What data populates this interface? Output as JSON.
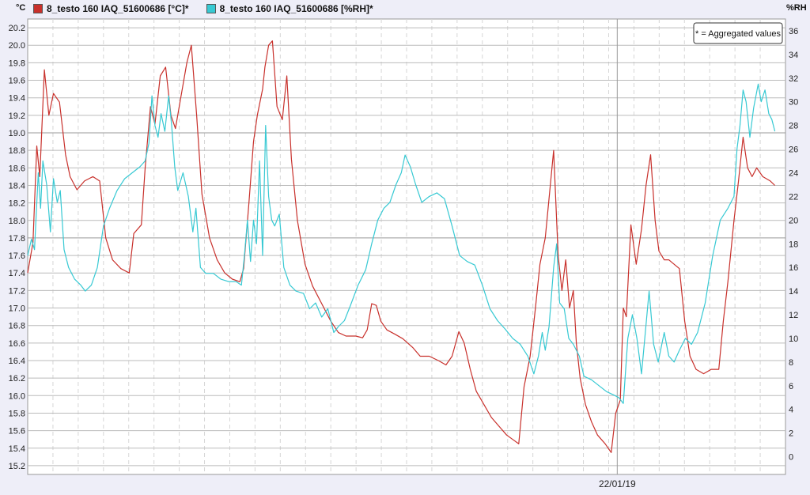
{
  "legend": {
    "temp_label": "8_testo 160 IAQ_51600686 [°C]*",
    "rh_label": "8_testo 160 IAQ_51600686 [%RH]*"
  },
  "axis_units": {
    "left": "°C",
    "right": "%RH"
  },
  "note": "* = Aggregated values",
  "colors": {
    "temp": "#c8302b",
    "rh": "#37c9d3",
    "grid": "#bbbbbb",
    "background": "#ffffff"
  },
  "chart_data": {
    "type": "line",
    "x_label": "22/01/19",
    "x_range": [
      0,
      100
    ],
    "y_left": {
      "label": "°C",
      "range": [
        15.1,
        20.3
      ],
      "ticks": [
        15.2,
        15.4,
        15.6,
        15.8,
        16.0,
        16.2,
        16.4,
        16.6,
        16.8,
        17.0,
        17.2,
        17.4,
        17.6,
        17.8,
        18.0,
        18.2,
        18.4,
        18.6,
        18.8,
        19.0,
        19.2,
        19.4,
        19.6,
        19.8,
        20.0,
        20.2
      ]
    },
    "y_right": {
      "label": "%RH",
      "range": [
        -1.5,
        37
      ],
      "ticks": [
        0,
        2,
        4,
        6,
        8,
        10,
        12,
        14,
        16,
        18,
        20,
        22,
        24,
        26,
        28,
        30,
        32,
        34,
        36
      ]
    },
    "series": [
      {
        "name": "8_testo 160 IAQ_51600686 [°C]*",
        "axis": "left",
        "points": [
          [
            0,
            17.4
          ],
          [
            0.7,
            17.75
          ],
          [
            1.2,
            18.85
          ],
          [
            1.6,
            18.5
          ],
          [
            2.2,
            19.72
          ],
          [
            2.8,
            19.2
          ],
          [
            3.4,
            19.45
          ],
          [
            4.2,
            19.35
          ],
          [
            5.0,
            18.75
          ],
          [
            5.6,
            18.5
          ],
          [
            6.5,
            18.35
          ],
          [
            7.5,
            18.45
          ],
          [
            8.6,
            18.5
          ],
          [
            9.5,
            18.45
          ],
          [
            10.3,
            17.8
          ],
          [
            11.2,
            17.55
          ],
          [
            12.3,
            17.45
          ],
          [
            13.4,
            17.4
          ],
          [
            14.0,
            17.85
          ],
          [
            15.0,
            17.95
          ],
          [
            15.5,
            18.6
          ],
          [
            16.2,
            19.3
          ],
          [
            16.8,
            19.1
          ],
          [
            17.5,
            19.65
          ],
          [
            18.2,
            19.75
          ],
          [
            18.9,
            19.2
          ],
          [
            19.5,
            19.05
          ],
          [
            20.2,
            19.4
          ],
          [
            21.0,
            19.8
          ],
          [
            21.6,
            20.0
          ],
          [
            22.3,
            19.2
          ],
          [
            23.0,
            18.3
          ],
          [
            24.0,
            17.8
          ],
          [
            25.0,
            17.55
          ],
          [
            26.0,
            17.4
          ],
          [
            27.0,
            17.33
          ],
          [
            28.0,
            17.3
          ],
          [
            28.5,
            17.45
          ],
          [
            29.2,
            18.2
          ],
          [
            29.8,
            18.9
          ],
          [
            30.3,
            19.2
          ],
          [
            31.0,
            19.5
          ],
          [
            31.3,
            19.75
          ],
          [
            31.8,
            20.0
          ],
          [
            32.3,
            20.05
          ],
          [
            32.9,
            19.3
          ],
          [
            33.6,
            19.15
          ],
          [
            34.2,
            19.65
          ],
          [
            34.8,
            18.7
          ],
          [
            35.6,
            18.0
          ],
          [
            36.6,
            17.5
          ],
          [
            37.6,
            17.25
          ],
          [
            38.8,
            17.05
          ],
          [
            40.0,
            16.85
          ],
          [
            41.0,
            16.72
          ],
          [
            42.0,
            16.68
          ],
          [
            43.3,
            16.68
          ],
          [
            44.2,
            16.66
          ],
          [
            44.8,
            16.75
          ],
          [
            45.4,
            17.05
          ],
          [
            46.0,
            17.03
          ],
          [
            46.6,
            16.85
          ],
          [
            47.4,
            16.75
          ],
          [
            48.5,
            16.7
          ],
          [
            49.5,
            16.65
          ],
          [
            50.8,
            16.55
          ],
          [
            51.8,
            16.45
          ],
          [
            53.0,
            16.45
          ],
          [
            54.2,
            16.4
          ],
          [
            55.2,
            16.35
          ],
          [
            56.0,
            16.45
          ],
          [
            56.9,
            16.73
          ],
          [
            57.6,
            16.6
          ],
          [
            58.4,
            16.3
          ],
          [
            59.2,
            16.05
          ],
          [
            60.2,
            15.9
          ],
          [
            61.2,
            15.75
          ],
          [
            62.2,
            15.65
          ],
          [
            63.2,
            15.55
          ],
          [
            64.0,
            15.5
          ],
          [
            64.8,
            15.45
          ],
          [
            65.5,
            16.1
          ],
          [
            66.3,
            16.45
          ],
          [
            67.0,
            17.0
          ],
          [
            67.6,
            17.5
          ],
          [
            68.3,
            17.8
          ],
          [
            68.8,
            18.25
          ],
          [
            69.4,
            18.8
          ],
          [
            70.0,
            17.6
          ],
          [
            70.5,
            17.2
          ],
          [
            71.0,
            17.55
          ],
          [
            71.5,
            17.0
          ],
          [
            72.0,
            17.2
          ],
          [
            72.4,
            16.6
          ],
          [
            72.9,
            16.2
          ],
          [
            73.6,
            15.9
          ],
          [
            74.4,
            15.7
          ],
          [
            75.2,
            15.55
          ],
          [
            76.2,
            15.45
          ],
          [
            77.0,
            15.35
          ],
          [
            77.6,
            15.8
          ],
          [
            78.2,
            15.95
          ],
          [
            78.6,
            17.0
          ],
          [
            79.0,
            16.9
          ],
          [
            79.6,
            17.95
          ],
          [
            80.3,
            17.5
          ],
          [
            81.0,
            17.9
          ],
          [
            81.6,
            18.4
          ],
          [
            82.2,
            18.75
          ],
          [
            82.8,
            18.0
          ],
          [
            83.3,
            17.65
          ],
          [
            84.0,
            17.55
          ],
          [
            84.6,
            17.55
          ],
          [
            85.3,
            17.5
          ],
          [
            86.0,
            17.45
          ],
          [
            86.7,
            16.85
          ],
          [
            87.4,
            16.45
          ],
          [
            88.2,
            16.3
          ],
          [
            89.2,
            16.25
          ],
          [
            90.2,
            16.3
          ],
          [
            91.2,
            16.3
          ],
          [
            91.8,
            16.85
          ],
          [
            92.4,
            17.3
          ],
          [
            93.2,
            18.0
          ],
          [
            93.8,
            18.45
          ],
          [
            94.4,
            18.95
          ],
          [
            95.0,
            18.6
          ],
          [
            95.6,
            18.5
          ],
          [
            96.2,
            18.6
          ],
          [
            97.0,
            18.5
          ],
          [
            98.0,
            18.45
          ],
          [
            98.6,
            18.4
          ]
        ]
      },
      {
        "name": "8_testo 160 IAQ_51600686 [%RH]*",
        "axis": "right",
        "points": [
          [
            0,
            17.0
          ],
          [
            0.5,
            18.4
          ],
          [
            0.9,
            17.5
          ],
          [
            1.4,
            24.0
          ],
          [
            1.7,
            21.0
          ],
          [
            2.0,
            25.0
          ],
          [
            2.5,
            23.0
          ],
          [
            3.0,
            19.0
          ],
          [
            3.4,
            23.5
          ],
          [
            3.9,
            21.5
          ],
          [
            4.3,
            22.5
          ],
          [
            4.8,
            17.5
          ],
          [
            5.4,
            16.0
          ],
          [
            6.2,
            15.0
          ],
          [
            7.0,
            14.5
          ],
          [
            7.6,
            14.0
          ],
          [
            8.4,
            14.5
          ],
          [
            9.2,
            16.0
          ],
          [
            10.0,
            19.5
          ],
          [
            10.8,
            21.0
          ],
          [
            11.8,
            22.5
          ],
          [
            12.8,
            23.5
          ],
          [
            13.8,
            24.0
          ],
          [
            14.8,
            24.5
          ],
          [
            15.5,
            25.0
          ],
          [
            16.0,
            26.5
          ],
          [
            16.4,
            30.5
          ],
          [
            16.8,
            28.0
          ],
          [
            17.2,
            27.0
          ],
          [
            17.6,
            29.0
          ],
          [
            18.1,
            27.5
          ],
          [
            18.6,
            30.5
          ],
          [
            19.0,
            28.0
          ],
          [
            19.4,
            24.5
          ],
          [
            19.8,
            22.5
          ],
          [
            20.5,
            24.0
          ],
          [
            21.2,
            22.0
          ],
          [
            21.8,
            19.0
          ],
          [
            22.2,
            21.0
          ],
          [
            22.8,
            16.0
          ],
          [
            23.5,
            15.5
          ],
          [
            24.5,
            15.5
          ],
          [
            25.5,
            15.0
          ],
          [
            26.5,
            14.8
          ],
          [
            27.5,
            14.8
          ],
          [
            28.2,
            14.5
          ],
          [
            28.6,
            17.0
          ],
          [
            29.0,
            20.0
          ],
          [
            29.4,
            16.5
          ],
          [
            29.8,
            20.0
          ],
          [
            30.2,
            18.0
          ],
          [
            30.6,
            25.0
          ],
          [
            31.0,
            17.0
          ],
          [
            31.4,
            28.0
          ],
          [
            31.8,
            22.0
          ],
          [
            32.2,
            20.0
          ],
          [
            32.6,
            19.5
          ],
          [
            33.2,
            20.5
          ],
          [
            33.8,
            16.0
          ],
          [
            34.6,
            14.5
          ],
          [
            35.4,
            14.0
          ],
          [
            36.4,
            13.8
          ],
          [
            37.2,
            12.5
          ],
          [
            38.0,
            13.0
          ],
          [
            38.8,
            11.8
          ],
          [
            39.6,
            12.5
          ],
          [
            40.4,
            10.5
          ],
          [
            41.0,
            11.0
          ],
          [
            41.8,
            11.5
          ],
          [
            42.6,
            12.8
          ],
          [
            43.6,
            14.5
          ],
          [
            44.6,
            15.8
          ],
          [
            45.4,
            18.0
          ],
          [
            46.2,
            20.0
          ],
          [
            47.0,
            21.0
          ],
          [
            47.8,
            21.5
          ],
          [
            48.6,
            23.0
          ],
          [
            49.3,
            24.0
          ],
          [
            49.8,
            25.5
          ],
          [
            50.5,
            24.5
          ],
          [
            51.2,
            23.0
          ],
          [
            52.0,
            21.5
          ],
          [
            53.0,
            22.0
          ],
          [
            54.0,
            22.3
          ],
          [
            55.0,
            21.8
          ],
          [
            56.0,
            19.5
          ],
          [
            57.0,
            17.0
          ],
          [
            58.0,
            16.5
          ],
          [
            59.0,
            16.2
          ],
          [
            60.0,
            14.5
          ],
          [
            61.0,
            12.5
          ],
          [
            62.0,
            11.5
          ],
          [
            63.0,
            10.8
          ],
          [
            64.0,
            10.0
          ],
          [
            65.0,
            9.5
          ],
          [
            66.0,
            8.5
          ],
          [
            66.8,
            7.0
          ],
          [
            67.4,
            8.5
          ],
          [
            67.9,
            10.5
          ],
          [
            68.3,
            9.0
          ],
          [
            68.8,
            11.0
          ],
          [
            69.4,
            16.0
          ],
          [
            69.8,
            18.0
          ],
          [
            70.2,
            13.0
          ],
          [
            70.8,
            12.5
          ],
          [
            71.4,
            10.0
          ],
          [
            72.0,
            9.5
          ],
          [
            72.8,
            8.5
          ],
          [
            73.4,
            6.8
          ],
          [
            74.4,
            6.5
          ],
          [
            75.4,
            6.0
          ],
          [
            76.4,
            5.5
          ],
          [
            77.4,
            5.2
          ],
          [
            78.0,
            5.0
          ],
          [
            78.6,
            4.5
          ],
          [
            79.2,
            10.0
          ],
          [
            79.8,
            12.0
          ],
          [
            80.4,
            10.0
          ],
          [
            81.0,
            7.0
          ],
          [
            81.5,
            10.5
          ],
          [
            82.0,
            14.0
          ],
          [
            82.6,
            9.5
          ],
          [
            83.2,
            8.0
          ],
          [
            84.0,
            10.5
          ],
          [
            84.6,
            8.5
          ],
          [
            85.3,
            8.0
          ],
          [
            86.0,
            9.0
          ],
          [
            86.8,
            10.0
          ],
          [
            87.6,
            9.5
          ],
          [
            88.4,
            10.5
          ],
          [
            89.4,
            13.0
          ],
          [
            90.4,
            17.0
          ],
          [
            91.4,
            20.0
          ],
          [
            92.4,
            21.0
          ],
          [
            93.2,
            22.0
          ],
          [
            93.6,
            26.0
          ],
          [
            94.0,
            28.0
          ],
          [
            94.4,
            31.0
          ],
          [
            94.8,
            30.0
          ],
          [
            95.3,
            27.0
          ],
          [
            95.8,
            29.5
          ],
          [
            96.4,
            31.5
          ],
          [
            96.8,
            30.0
          ],
          [
            97.3,
            31.0
          ],
          [
            97.8,
            29.0
          ],
          [
            98.2,
            28.5
          ],
          [
            98.6,
            27.5
          ]
        ]
      }
    ]
  }
}
